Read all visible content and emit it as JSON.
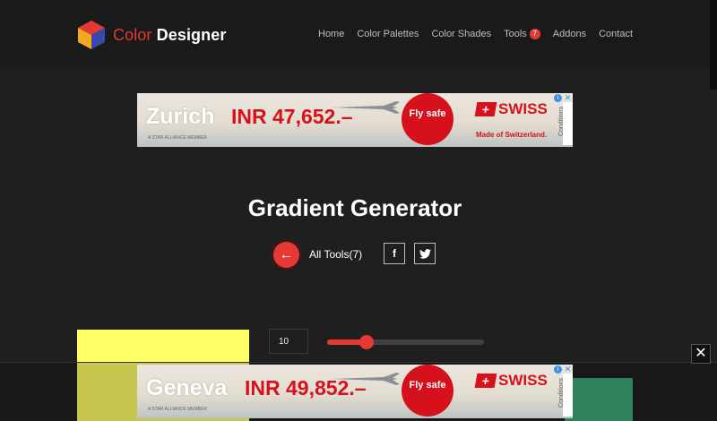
{
  "brand": {
    "word1": "Color",
    "word2": "Designer",
    "accent": "#e53935"
  },
  "nav": {
    "items": [
      {
        "label": "Home"
      },
      {
        "label": "Color Palettes"
      },
      {
        "label": "Color Shades"
      },
      {
        "label": "Tools",
        "badge": "7"
      },
      {
        "label": "Addons"
      },
      {
        "label": "Contact"
      }
    ]
  },
  "ad_top": {
    "city": "Zurich",
    "price": "INR 47,652.–",
    "cta": "Fly safe",
    "brand": "SWISS",
    "tagline": "Made of Switzerland.",
    "side_label": "Conditions",
    "fine_print": "A STAR ALLIANCE MEMBER"
  },
  "ad_bottom": {
    "city": "Geneva",
    "price": "INR 49,852.–",
    "cta": "Fly safe",
    "brand": "SWISS",
    "side_label": "Conditions",
    "fine_print": "A STAR ALLIANCE MEMBER"
  },
  "page": {
    "title": "Gradient Generator",
    "all_tools": "All Tools(7)",
    "back_icon": "arrow-left-icon",
    "social": [
      "facebook-icon",
      "twitter-icon"
    ]
  },
  "controls": {
    "steps_value": "10",
    "slider_fraction": 0.25,
    "start_color": "#ffff66",
    "end_color": "#3aa678"
  },
  "overlay": {
    "close_glyph": "✕"
  }
}
